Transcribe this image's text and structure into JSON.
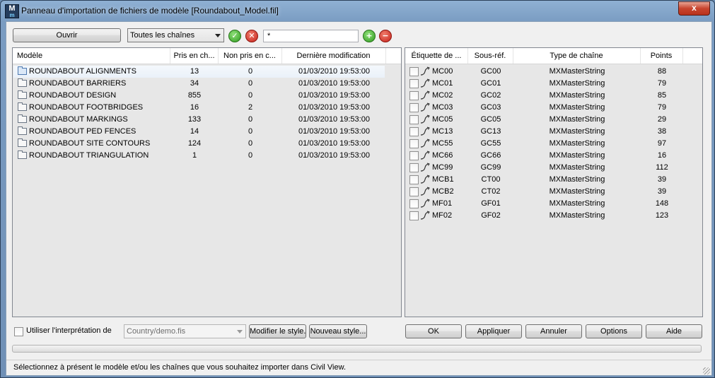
{
  "window": {
    "title": "Panneau d'importation de fichiers de modèle [Roundabout_Model.fil]",
    "app_icon": "M",
    "close_label": "x"
  },
  "toolbar": {
    "open_label": "Ouvrir",
    "chain_filter_value": "Toutes les chaînes",
    "filter_value": "*"
  },
  "models": {
    "columns": [
      "Modèle",
      "Pris en ch...",
      "Non pris en c...",
      "Dernière modification"
    ],
    "rows": [
      {
        "name": "ROUNDABOUT ALIGNMENTS",
        "taken": "13",
        "not_taken": "0",
        "modified": "01/03/2010 19:53:00"
      },
      {
        "name": "ROUNDABOUT BARRIERS",
        "taken": "34",
        "not_taken": "0",
        "modified": "01/03/2010 19:53:00"
      },
      {
        "name": "ROUNDABOUT DESIGN",
        "taken": "855",
        "not_taken": "0",
        "modified": "01/03/2010 19:53:00"
      },
      {
        "name": "ROUNDABOUT FOOTBRIDGES",
        "taken": "16",
        "not_taken": "2",
        "modified": "01/03/2010 19:53:00"
      },
      {
        "name": "ROUNDABOUT MARKINGS",
        "taken": "133",
        "not_taken": "0",
        "modified": "01/03/2010 19:53:00"
      },
      {
        "name": "ROUNDABOUT PED FENCES",
        "taken": "14",
        "not_taken": "0",
        "modified": "01/03/2010 19:53:00"
      },
      {
        "name": "ROUNDABOUT SITE CONTOURS",
        "taken": "124",
        "not_taken": "0",
        "modified": "01/03/2010 19:53:00"
      },
      {
        "name": "ROUNDABOUT TRIANGULATION",
        "taken": "1",
        "not_taken": "0",
        "modified": "01/03/2010 19:53:00"
      }
    ]
  },
  "strings": {
    "columns": [
      "Étiquette de ...",
      "Sous-réf.",
      "Type de chaîne",
      "Points"
    ],
    "rows": [
      {
        "label": "MC00",
        "subref": "GC00",
        "type": "MXMasterString",
        "points": "88"
      },
      {
        "label": "MC01",
        "subref": "GC01",
        "type": "MXMasterString",
        "points": "79"
      },
      {
        "label": "MC02",
        "subref": "GC02",
        "type": "MXMasterString",
        "points": "85"
      },
      {
        "label": "MC03",
        "subref": "GC03",
        "type": "MXMasterString",
        "points": "79"
      },
      {
        "label": "MC05",
        "subref": "GC05",
        "type": "MXMasterString",
        "points": "29"
      },
      {
        "label": "MC13",
        "subref": "GC13",
        "type": "MXMasterString",
        "points": "38"
      },
      {
        "label": "MC55",
        "subref": "GC55",
        "type": "MXMasterString",
        "points": "97"
      },
      {
        "label": "MC66",
        "subref": "GC66",
        "type": "MXMasterString",
        "points": "16"
      },
      {
        "label": "MC99",
        "subref": "GC99",
        "type": "MXMasterString",
        "points": "112"
      },
      {
        "label": "MCB1",
        "subref": "CT00",
        "type": "MXMasterString",
        "points": "39"
      },
      {
        "label": "MCB2",
        "subref": "CT02",
        "type": "MXMasterString",
        "points": "39"
      },
      {
        "label": "MF01",
        "subref": "GF01",
        "type": "MXMasterString",
        "points": "148"
      },
      {
        "label": "MF02",
        "subref": "GF02",
        "type": "MXMasterString",
        "points": "123"
      }
    ]
  },
  "bottom": {
    "use_interpretation_label": "Utiliser l'interprétation de",
    "style_file_value": "Country/demo.fis",
    "modify_style_label": "Modifier le style...",
    "new_style_label": "Nouveau style...",
    "ok_label": "OK",
    "apply_label": "Appliquer",
    "cancel_label": "Annuler",
    "options_label": "Options",
    "help_label": "Aide"
  },
  "status_text": "Sélectionnez à présent le modèle et/ou les chaînes que vous souhaitez importer dans Civil View."
}
